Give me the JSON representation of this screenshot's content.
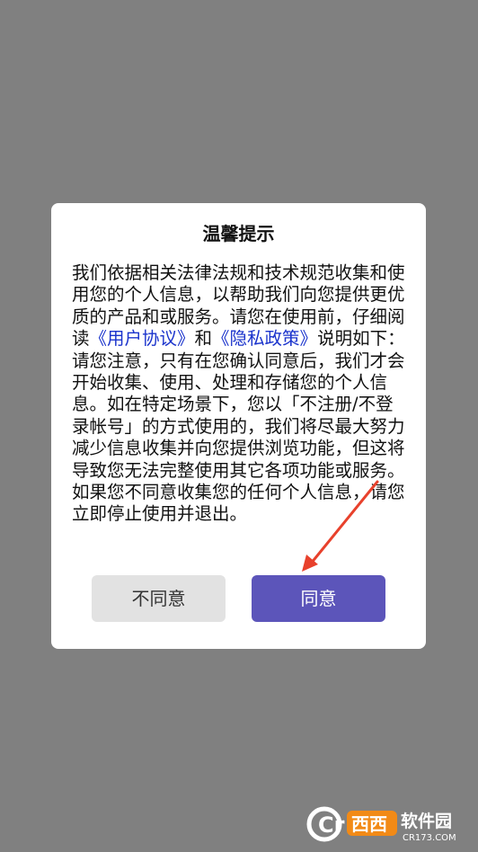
{
  "dialog": {
    "title": "温馨提示",
    "body_before_link1": "我们依据相关法律法规和技术规范收集和使用您的个人信息，以帮助我们向您提供更优质的产品和或服务。请您在使用前，仔细阅读",
    "link_user_agreement": "《用户协议》",
    "body_between_links": "和",
    "link_privacy_policy": "《隐私政策》",
    "body_after_link2": "说明如下：请您注意，只有在您确认同意后，我们才会开始收集、使用、处理和存储您的个人信息。如在特定场景下，您以「不注册/不登录帐号」的方式使用的，我们将尽最大努力减少信息收集并向您提供浏览功能，但这将导致您无法完整使用其它各项功能或服务。如果您不同意收集您的任何个人信息，请您立即停止使用并退出。",
    "disagree_label": "不同意",
    "agree_label": "同意"
  },
  "annotation": {
    "arrow_color": "#e8412c",
    "arrow_target": "agree-button"
  },
  "watermark": {
    "logo_text": "西西",
    "brand_text": "软件园",
    "domain_text": "CR173.COM",
    "logo_letters": "Cr"
  },
  "colors": {
    "backdrop": "#808080",
    "agree_button": "#5c55ba",
    "disagree_button": "#e2e2e2",
    "link": "#1a33cc"
  }
}
